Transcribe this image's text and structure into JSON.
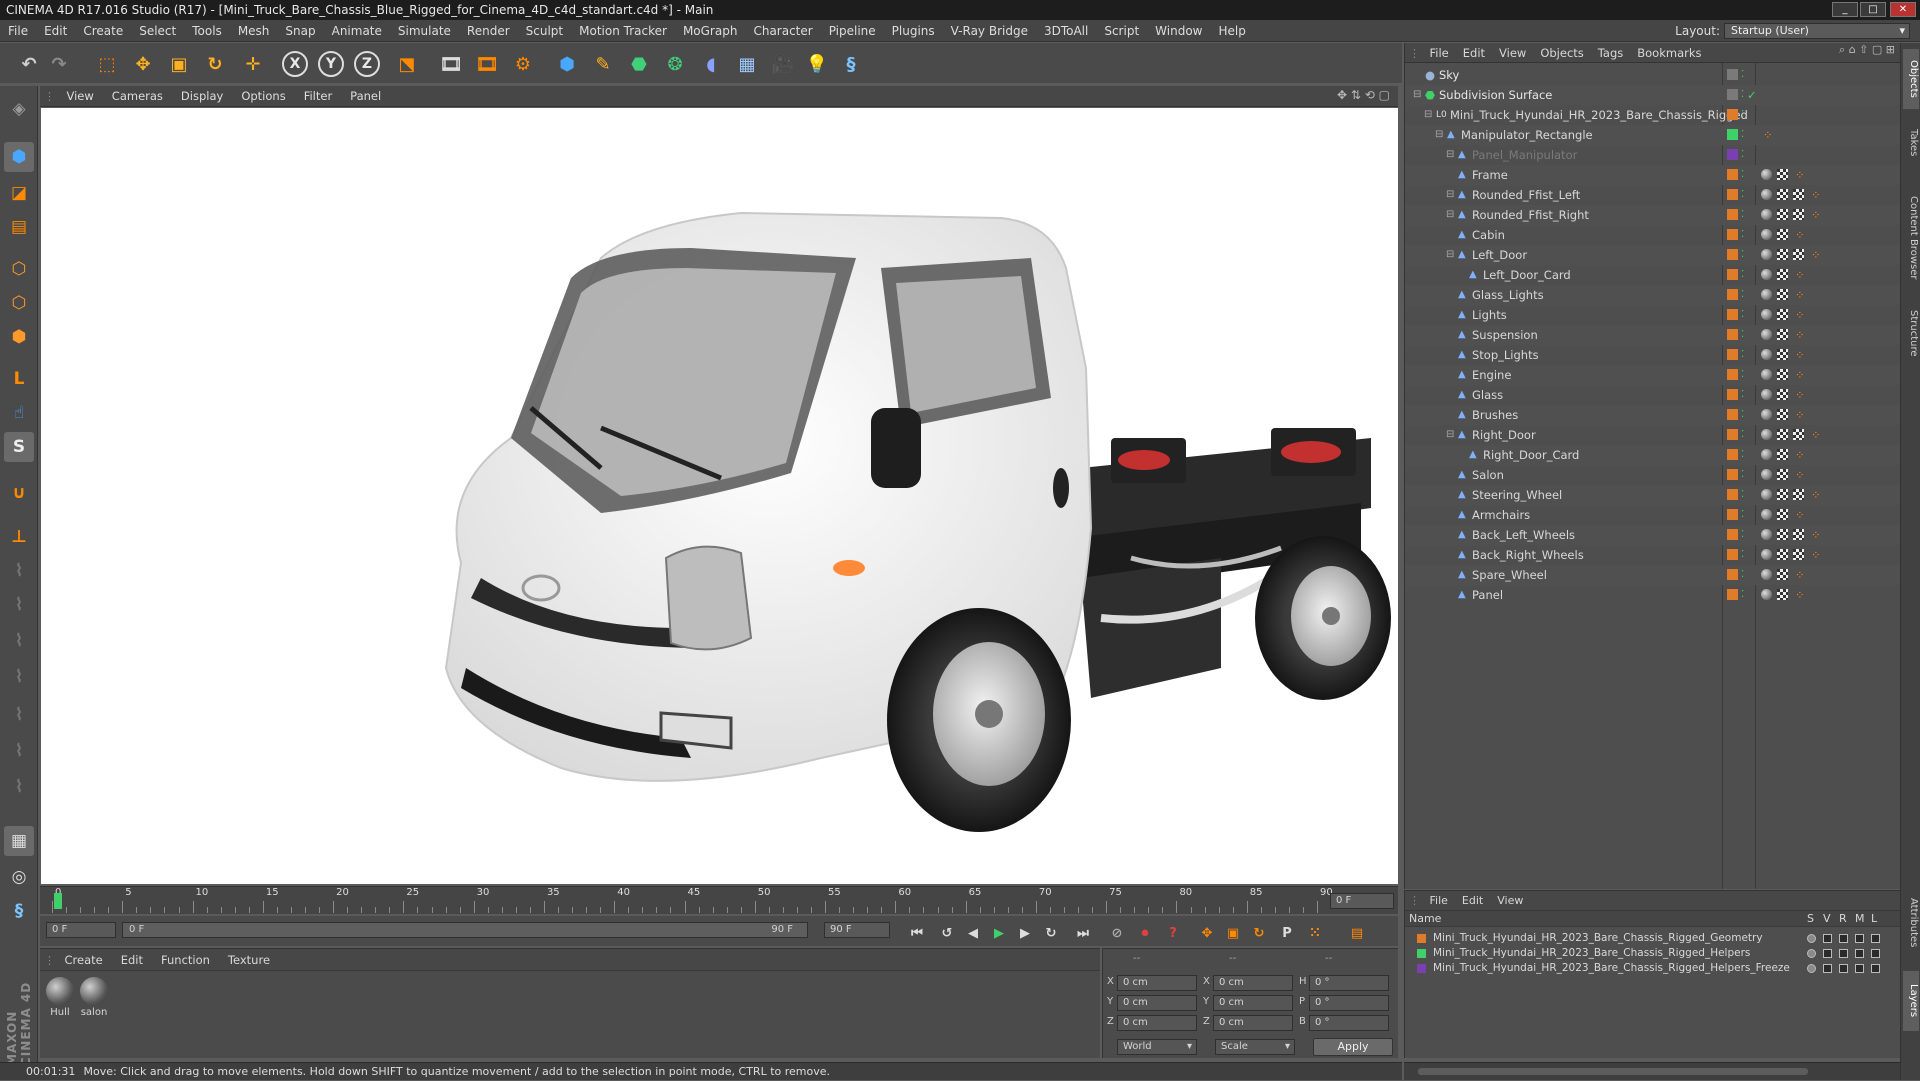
{
  "window": {
    "title": "CINEMA 4D R17.016 Studio (R17) - [Mini_Truck_Bare_Chassis_Blue_Rigged_for_Cinema_4D_c4d_standart.c4d *] - Main",
    "min": "_",
    "max": "□",
    "close": "✕"
  },
  "menu": [
    "File",
    "Edit",
    "Create",
    "Select",
    "Tools",
    "Mesh",
    "Snap",
    "Animate",
    "Simulate",
    "Render",
    "Sculpt",
    "Motion Tracker",
    "MoGraph",
    "Character",
    "Pipeline",
    "Plugins",
    "V-Ray Bridge",
    "3DToAll",
    "Script",
    "Window",
    "Help"
  ],
  "layout": {
    "label": "Layout:",
    "value": "Startup (User)"
  },
  "toolbar_icons": [
    {
      "name": "undo-icon",
      "glyph": "↶",
      "color": "#cfcfcf"
    },
    {
      "name": "redo-icon",
      "glyph": "↷",
      "color": "#8a8a8a"
    },
    {
      "name": "live-selection-icon",
      "glyph": "⬚",
      "color": "#ff7b00"
    },
    {
      "name": "move-icon",
      "glyph": "✥",
      "color": "#ffb020"
    },
    {
      "name": "scale-icon",
      "glyph": "▣",
      "color": "#ffb020"
    },
    {
      "name": "rotate-icon",
      "glyph": "↻",
      "color": "#ffb020"
    },
    {
      "name": "transform-icon",
      "glyph": "✛",
      "color": "#ffb020"
    },
    {
      "name": "x-axis-icon",
      "glyph": "X",
      "color": "#e8e8e8"
    },
    {
      "name": "y-axis-icon",
      "glyph": "Y",
      "color": "#e8e8e8"
    },
    {
      "name": "z-axis-icon",
      "glyph": "Z",
      "color": "#e8e8e8"
    },
    {
      "name": "coordinate-system-icon",
      "glyph": "⬔",
      "color": "#ff8a00"
    },
    {
      "name": "render-view-icon",
      "glyph": "🎞",
      "color": "#dddddd"
    },
    {
      "name": "render-picture-viewer-icon",
      "glyph": "🎞",
      "color": "#ff8a00"
    },
    {
      "name": "render-settings-icon",
      "glyph": "⚙",
      "color": "#ff8a00"
    },
    {
      "name": "cube-icon",
      "glyph": "⬢",
      "color": "#4aa7ff"
    },
    {
      "name": "pen-spline-icon",
      "glyph": "✎",
      "color": "#ffb020"
    },
    {
      "name": "subdivision-icon",
      "glyph": "⬣",
      "color": "#41d07a"
    },
    {
      "name": "array-icon",
      "glyph": "❂",
      "color": "#41d07a"
    },
    {
      "name": "deformer-icon",
      "glyph": "◖",
      "color": "#8aa0ff"
    },
    {
      "name": "floor-icon",
      "glyph": "▦",
      "color": "#9ecbff"
    },
    {
      "name": "camera-icon",
      "glyph": "🎥",
      "color": "#dddddd"
    },
    {
      "name": "light-icon",
      "glyph": "💡",
      "color": "#eeeeee"
    },
    {
      "name": "python-icon",
      "glyph": "§",
      "color": "#7cc4ff"
    }
  ],
  "left_tools": [
    {
      "name": "make-editable-icon",
      "glyph": "◈",
      "color": "#9a9a9a"
    },
    {
      "name": "model-mode-icon",
      "glyph": "⬢",
      "color": "#4aa7ff"
    },
    {
      "name": "texture-mode-icon",
      "glyph": "◪",
      "color": "#ff8a00"
    },
    {
      "name": "workplane-icon",
      "glyph": "▤",
      "color": "#ff8a00"
    },
    {
      "name": "points-mode-icon",
      "glyph": "⬡",
      "color": "#ff9a2a"
    },
    {
      "name": "edges-mode-icon",
      "glyph": "⬡",
      "color": "#ff9a2a"
    },
    {
      "name": "polygons-mode-icon",
      "glyph": "⬢",
      "color": "#ff9a2a"
    },
    {
      "name": "axis-mode-icon",
      "glyph": "L",
      "color": "#ff8a00"
    },
    {
      "name": "tweak-mode-icon",
      "glyph": "☝",
      "color": "#4aa7ff"
    },
    {
      "name": "snap-icon",
      "glyph": "S",
      "color": "#eeeeee"
    },
    {
      "name": "magnet-icon",
      "glyph": "∪",
      "color": "#ff8a00"
    },
    {
      "name": "workplane-axis-icon",
      "glyph": "⊥",
      "color": "#ff8a00"
    },
    {
      "name": "sculpt-brush-1-icon",
      "glyph": "⌇",
      "color": "#777777"
    },
    {
      "name": "sculpt-brush-2-icon",
      "glyph": "⌇",
      "color": "#777777"
    },
    {
      "name": "sculpt-brush-3-icon",
      "glyph": "⌇",
      "color": "#777777"
    },
    {
      "name": "sculpt-brush-4-icon",
      "glyph": "⌇",
      "color": "#777777"
    },
    {
      "name": "sculpt-brush-5-icon",
      "glyph": "⌇",
      "color": "#777777"
    },
    {
      "name": "sculpt-brush-6-icon",
      "glyph": "⌇",
      "color": "#777777"
    },
    {
      "name": "sculpt-brush-7-icon",
      "glyph": "⌇",
      "color": "#777777"
    },
    {
      "name": "lock-grid-icon",
      "glyph": "▦",
      "color": "#dddddd"
    },
    {
      "name": "python-generator-icon",
      "glyph": "◎",
      "color": "#dddddd"
    },
    {
      "name": "script-icon",
      "glyph": "§",
      "color": "#7cc4ff"
    }
  ],
  "viewport_menu": [
    "View",
    "Cameras",
    "Display",
    "Options",
    "Filter",
    "Panel"
  ],
  "timeline": {
    "ticks": [
      "0",
      "5",
      "10",
      "15",
      "20",
      "25",
      "30",
      "35",
      "40",
      "45",
      "50",
      "55",
      "60",
      "65",
      "70",
      "75",
      "80",
      "85",
      "90"
    ],
    "current": "0 F"
  },
  "transport": {
    "start": "0 F",
    "range_start": "0 F",
    "range_end": "90 F",
    "end": "90 F"
  },
  "material_menu": [
    "Create",
    "Edit",
    "Function",
    "Texture"
  ],
  "materials": [
    {
      "name": "Hull"
    },
    {
      "name": "salon"
    }
  ],
  "coords": {
    "header": [
      "--",
      "--",
      "--"
    ],
    "rows": [
      {
        "a": "X",
        "pos": "0 cm",
        "b": "X",
        "size": "0 cm",
        "c": "H",
        "rot": "0 °"
      },
      {
        "a": "Y",
        "pos": "0 cm",
        "b": "Y",
        "size": "0 cm",
        "c": "P",
        "rot": "0 °"
      },
      {
        "a": "Z",
        "pos": "0 cm",
        "b": "Z",
        "size": "0 cm",
        "c": "B",
        "rot": "0 °"
      }
    ],
    "world": "World",
    "scale": "Scale",
    "apply": "Apply"
  },
  "status": {
    "time": "00:01:31",
    "message": "Move: Click and drag to move elements. Hold down SHIFT to quantize movement / add to the selection in point mode, CTRL to remove."
  },
  "objects_menu": [
    "File",
    "Edit",
    "View",
    "Objects",
    "Tags",
    "Bookmarks"
  ],
  "objects": [
    {
      "name": "Sky",
      "depth": 0,
      "icon": "sky"
    },
    {
      "name": "Subdivision Surface",
      "depth": 0,
      "icon": "subd"
    },
    {
      "name": "Mini_Truck_Hyundai_HR_2023_Bare_Chassis_Rigged",
      "depth": 1,
      "icon": "null"
    },
    {
      "name": "Manipulator_Rectangle",
      "depth": 2,
      "icon": "bone"
    },
    {
      "name": "Panel_Manipulator",
      "depth": 3,
      "icon": "bone",
      "dim": true
    },
    {
      "name": "Frame",
      "depth": 3,
      "icon": "bone"
    },
    {
      "name": "Rounded_Ffist_Left",
      "depth": 3,
      "icon": "bone"
    },
    {
      "name": "Rounded_Ffist_Right",
      "depth": 3,
      "icon": "bone"
    },
    {
      "name": "Cabin",
      "depth": 3,
      "icon": "bone"
    },
    {
      "name": "Left_Door",
      "depth": 3,
      "icon": "bone"
    },
    {
      "name": "Left_Door_Card",
      "depth": 4,
      "icon": "bone"
    },
    {
      "name": "Glass_Lights",
      "depth": 3,
      "icon": "bone"
    },
    {
      "name": "Lights",
      "depth": 3,
      "icon": "bone"
    },
    {
      "name": "Suspension",
      "depth": 3,
      "icon": "bone"
    },
    {
      "name": "Stop_Lights",
      "depth": 3,
      "icon": "bone"
    },
    {
      "name": "Engine",
      "depth": 3,
      "icon": "bone"
    },
    {
      "name": "Glass",
      "depth": 3,
      "icon": "bone"
    },
    {
      "name": "Brushes",
      "depth": 3,
      "icon": "bone"
    },
    {
      "name": "Right_Door",
      "depth": 3,
      "icon": "bone"
    },
    {
      "name": "Right_Door_Card",
      "depth": 4,
      "icon": "bone"
    },
    {
      "name": "Salon",
      "depth": 3,
      "icon": "bone"
    },
    {
      "name": "Steering_Wheel",
      "depth": 3,
      "icon": "bone"
    },
    {
      "name": "Armchairs",
      "depth": 3,
      "icon": "bone"
    },
    {
      "name": "Back_Left_Wheels",
      "depth": 3,
      "icon": "bone"
    },
    {
      "name": "Back_Right_Wheels",
      "depth": 3,
      "icon": "bone"
    },
    {
      "name": "Spare_Wheel",
      "depth": 3,
      "icon": "bone"
    },
    {
      "name": "Panel",
      "depth": 3,
      "icon": "bone"
    }
  ],
  "layers_menu": [
    "File",
    "Edit",
    "View"
  ],
  "layers_header": {
    "name": "Name",
    "cols": [
      "S",
      "V",
      "R",
      "M",
      "L"
    ]
  },
  "layers": [
    {
      "name": "Mini_Truck_Hyundai_HR_2023_Bare_Chassis_Rigged_Geometry",
      "color": "#e07b2a"
    },
    {
      "name": "Mini_Truck_Hyundai_HR_2023_Bare_Chassis_Rigged_Helpers",
      "color": "#3fd06a"
    },
    {
      "name": "Mini_Truck_Hyundai_HR_2023_Bare_Chassis_Rigged_Helpers_Freeze",
      "color": "#7a3fb0"
    }
  ],
  "right_tabs": [
    "Objects",
    "Takes",
    "Content Browser",
    "Structure",
    "Attributes",
    "Layers"
  ],
  "brand": "MAXON CINEMA 4D",
  "colors": {
    "accent": "#ff8a00",
    "layer_orange": "#e07b2a",
    "layer_green": "#3fd06a"
  }
}
